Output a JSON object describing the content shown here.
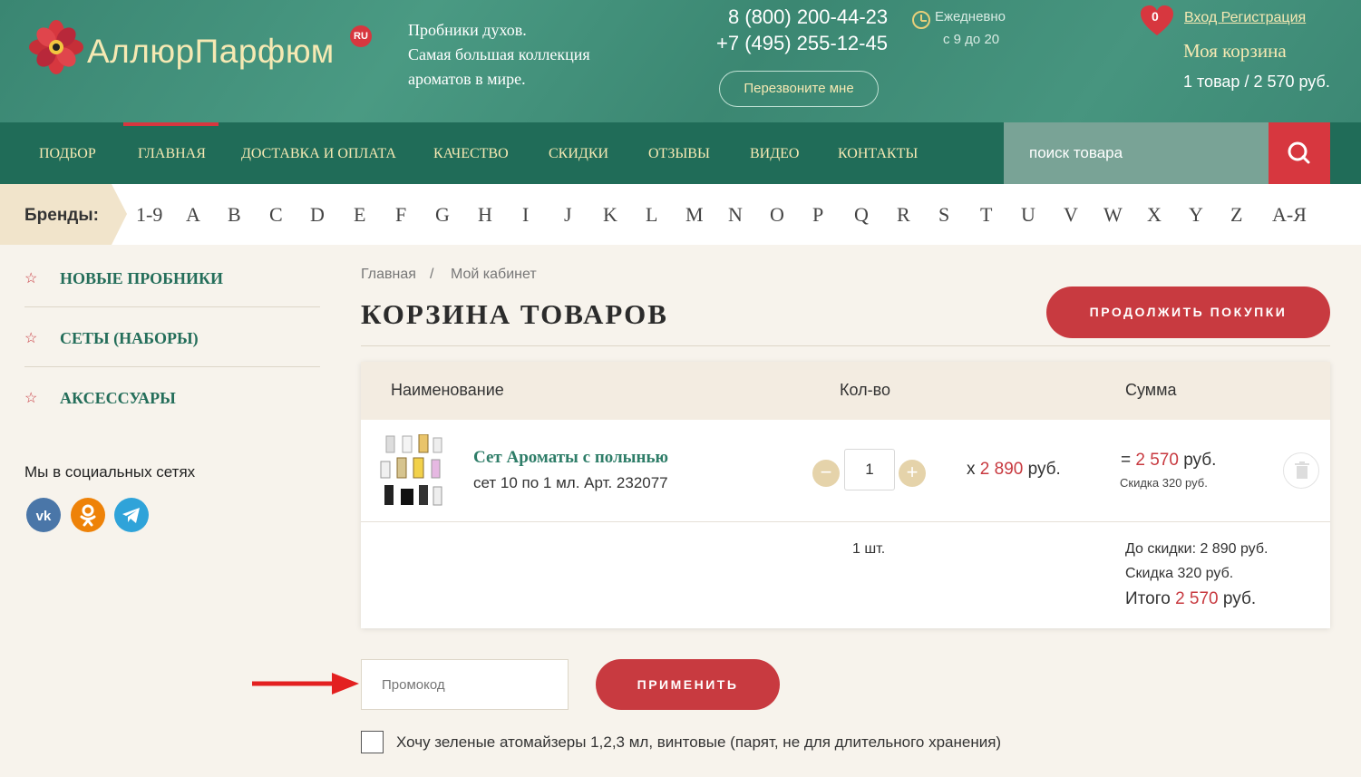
{
  "header": {
    "logo_text": "АллюрПарфюм",
    "logo_badge": "RU",
    "slogan": [
      "Пробники духов.",
      "Самая большая коллекция",
      "ароматов в мире."
    ],
    "phone1": "8 (800) 200-44-23",
    "phone2": "+7 (495) 255-12-45",
    "callback_label": "Перезвоните мне",
    "hours_line1": "Ежедневно",
    "hours_line2": "с 9 до 20",
    "favorites_count": "0",
    "auth_label": "Вход Регистрация",
    "cart_title": "Моя корзина",
    "cart_summary": "1 товар / 2 570 руб.",
    "colors": {
      "header_bg": "#3d8c77",
      "nav_bg": "#206c58",
      "accent_red": "#c83a40",
      "gold": "#f6e9b3"
    }
  },
  "nav": {
    "items": [
      "ПОДБОР",
      "ГЛАВНАЯ",
      "ДОСТАВКА И ОПЛАТА",
      "КАЧЕСТВО",
      "СКИДКИ",
      "ОТЗЫВЫ",
      "ВИДЕО",
      "КОНТАКТЫ"
    ],
    "active": "ГЛАВНАЯ",
    "search_placeholder": "поиск товара",
    "search_icon": "search-icon"
  },
  "brands": {
    "label": "Бренды:",
    "letters": [
      "1-9",
      "A",
      "B",
      "C",
      "D",
      "E",
      "F",
      "G",
      "H",
      "I",
      "J",
      "K",
      "L",
      "M",
      "N",
      "O",
      "P",
      "Q",
      "R",
      "S",
      "T",
      "U",
      "V",
      "W",
      "X",
      "Y",
      "Z",
      "А-Я"
    ]
  },
  "sidebar": {
    "items": [
      "НОВЫЕ ПРОБНИКИ",
      "СЕТЫ (НАБОРЫ)",
      "АКСЕССУАРЫ"
    ],
    "social_title": "Мы в социальных сетях",
    "social": [
      {
        "name": "vk-icon",
        "color": "#4a76a8"
      },
      {
        "name": "odnoklassniki-icon",
        "color": "#ee8208"
      },
      {
        "name": "telegram-icon",
        "color": "#2fa3d9"
      }
    ]
  },
  "main": {
    "breadcrumb": [
      "Главная",
      "/",
      "Мой кабинет"
    ],
    "title": "КОРЗИНА ТОВАРОВ",
    "continue_label": "ПРОДОЛЖИТЬ ПОКУПКИ",
    "table": {
      "headers": [
        "Наименование",
        "Кол-во",
        "Сумма"
      ],
      "item": {
        "name": "Сет Ароматы с полынью",
        "subtitle": "сет 10 по 1 мл. Арт. 232077",
        "qty": "1",
        "price_prefix": "x ",
        "price": "2 890",
        "price_suffix": " руб.",
        "sum_prefix": "= ",
        "sum": "2 570",
        "sum_suffix": " руб.",
        "discount_note": "Скидка 320 руб."
      },
      "totals": {
        "count": "1 шт.",
        "before_discount": "До скидки: 2 890 руб.",
        "discount": "Скидка 320 руб.",
        "total_prefix": "Итого ",
        "total": "2 570",
        "total_suffix": " руб."
      }
    },
    "promo_placeholder": "Промокод",
    "apply_label": "ПРИМЕНИТЬ",
    "atomizer_label": "Хочу зеленые атомайзеры 1,2,3 мл, винтовые (парят, не для длительного хранения)"
  }
}
